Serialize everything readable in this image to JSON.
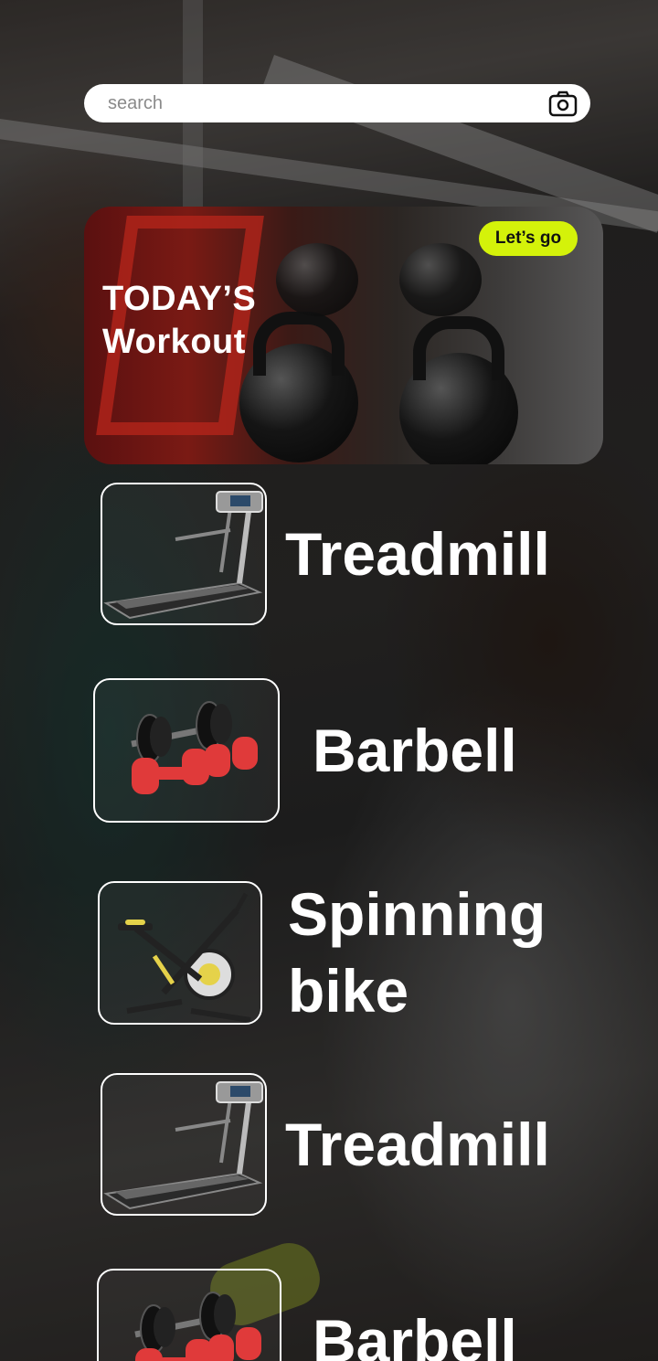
{
  "search": {
    "placeholder": "search",
    "camera_icon": "camera-icon"
  },
  "hero": {
    "title_line1": "TODAY’S",
    "title_line2": "Workout",
    "cta": "Let’s go",
    "accent": "#d4f20a"
  },
  "equipment": [
    {
      "label": "Treadmill",
      "icon": "treadmill-icon"
    },
    {
      "label": "Barbell",
      "icon": "dumbbell-icon"
    },
    {
      "label": "Spinning bike",
      "icon": "spinning-bike-icon"
    },
    {
      "label": "Treadmill",
      "icon": "treadmill-icon"
    },
    {
      "label": "Barbell",
      "icon": "dumbbell-icon"
    }
  ]
}
